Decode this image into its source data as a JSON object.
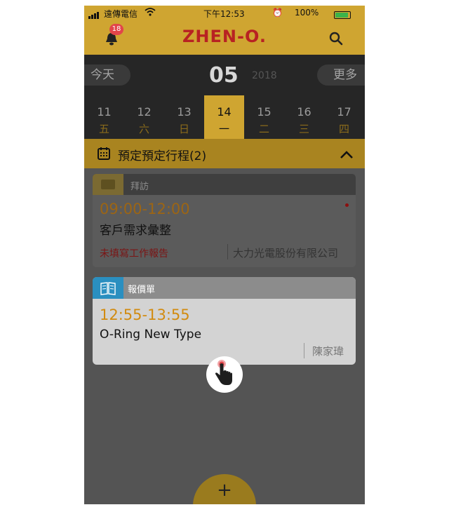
{
  "status_bar": {
    "carrier": "遠傳電信",
    "time": "下午12:53",
    "battery": "100%"
  },
  "header": {
    "logo": "ZHEN-O.",
    "notification_count": "18"
  },
  "month_bar": {
    "today_label": "今天",
    "month": "05",
    "year": "2018",
    "more_label": "更多"
  },
  "week": [
    {
      "num": "11",
      "weekday": "五"
    },
    {
      "num": "12",
      "weekday": "六"
    },
    {
      "num": "13",
      "weekday": "日"
    },
    {
      "num": "14",
      "weekday": "一"
    },
    {
      "num": "15",
      "weekday": "二"
    },
    {
      "num": "16",
      "weekday": "三"
    },
    {
      "num": "17",
      "weekday": "四"
    }
  ],
  "selected_day": "14",
  "section": {
    "title": "預定預定行程(2)"
  },
  "cards": [
    {
      "type": "拜訪",
      "time": "09:00-12:00",
      "title": "客戶需求彙整",
      "status": "未填寫工作報告",
      "company": "大力光電股份有限公司"
    },
    {
      "type": "報價單",
      "time": "12:55-13:55",
      "title": "O-Ring New Type",
      "person": "陳家瑋"
    }
  ],
  "fab": {
    "label": "+"
  },
  "colors": {
    "brand_gold": "#cfa531",
    "time_orange": "#d28b10",
    "quote_blue": "#2a8fc0",
    "warning_red": "#7b1515"
  }
}
